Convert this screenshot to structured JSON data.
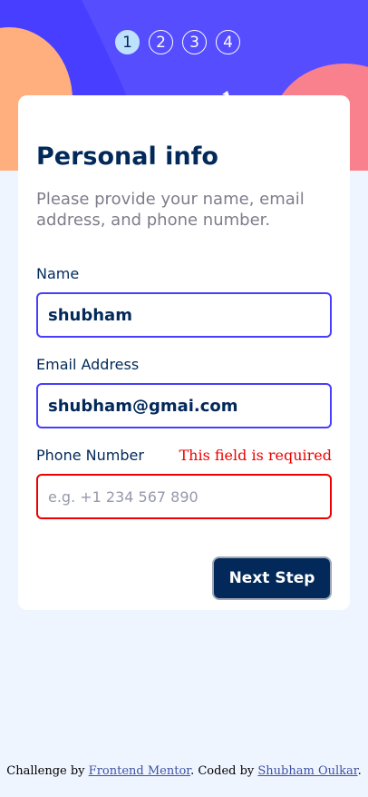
{
  "steps": [
    "1",
    "2",
    "3",
    "4"
  ],
  "active_step": 1,
  "colors": {
    "primary": "#483eff",
    "marine_blue": "#022959",
    "error": "#ee0000",
    "orange_blob": "#ffaf7e",
    "pink_blob": "#f9818e",
    "active_step_bg": "#bee2fd"
  },
  "form": {
    "title": "Personal info",
    "subtitle": "Please provide your name, email address, and phone number.",
    "name": {
      "label": "Name",
      "value": "shubham"
    },
    "email": {
      "label": "Email Address",
      "value": "shubham@gmai.com"
    },
    "phone": {
      "label": "Phone Number",
      "value": "",
      "placeholder": "e.g. +1 234 567 890",
      "error": "This field is required"
    },
    "next_label": "Next Step"
  },
  "footer": {
    "challenge_by": "Challenge by",
    "frontend_mentor": "Frontend Mentor",
    "coded_by": ". Coded by",
    "author": "Shubham Oulkar",
    "end": "."
  }
}
